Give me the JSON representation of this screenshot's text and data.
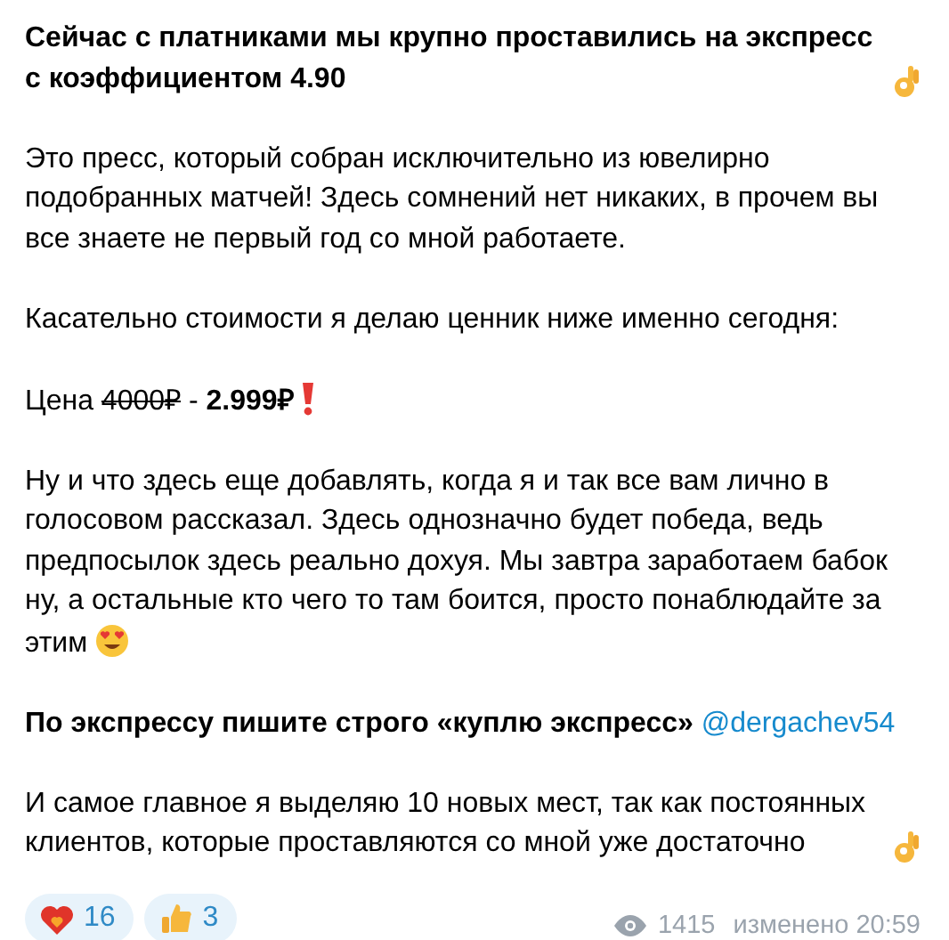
{
  "message": {
    "paragraphs": [
      {
        "kind": "title",
        "parts": [
          {
            "kind": "plain",
            "text": "Сейчас с платниками мы крупно проставились на экспресс с коэффициентом 4.90"
          }
        ]
      },
      {
        "kind": "text",
        "parts": [
          {
            "kind": "plain",
            "text": "Это пресс, который собран исключительно из ювелирно подобранных матчей! Здесь сомнений нет никаких, в прочем вы все знаете не первый год со мной работаете."
          }
        ]
      },
      {
        "kind": "text",
        "parts": [
          {
            "kind": "plain",
            "text": "Касательно стоимости я делаю ценник ниже именно сегодня:"
          }
        ]
      },
      {
        "kind": "text",
        "parts": [
          {
            "kind": "plain",
            "text": "Цена"
          },
          {
            "kind": "strike",
            "text": "4000₽"
          },
          {
            "kind": "plain",
            "text": "-"
          },
          {
            "kind": "bold",
            "text": "2.999₽"
          }
        ]
      },
      {
        "kind": "text",
        "parts": [
          {
            "kind": "plain",
            "text": "Ну и что здесь еще добавлять, когда я и так все вам лично в голосовом рассказал. Здесь однозначно будет победа, ведь предпосылок здесь реально дохуя. Мы завтра заработаем бабок ну, а остальные кто чего то там боится, просто понаблюдайте за этим"
          }
        ]
      },
      {
        "kind": "text",
        "parts": [
          {
            "kind": "bold",
            "text": "По экспрессу пишите строго «куплю экспресс»"
          },
          {
            "kind": "link",
            "text": "@dergachev54"
          }
        ]
      },
      {
        "kind": "text",
        "parts": [
          {
            "kind": "plain",
            "text": "И самое главное я выделяю 10 новых мест, так как постоянных клиентов, которые проставляются со мной уже достаточно"
          }
        ]
      }
    ],
    "reactions": [
      {
        "kind": "heart",
        "count": "16"
      },
      {
        "kind": "thumbs",
        "count": "3"
      }
    ],
    "views": "1415",
    "edited": "изменено 20:59"
  }
}
